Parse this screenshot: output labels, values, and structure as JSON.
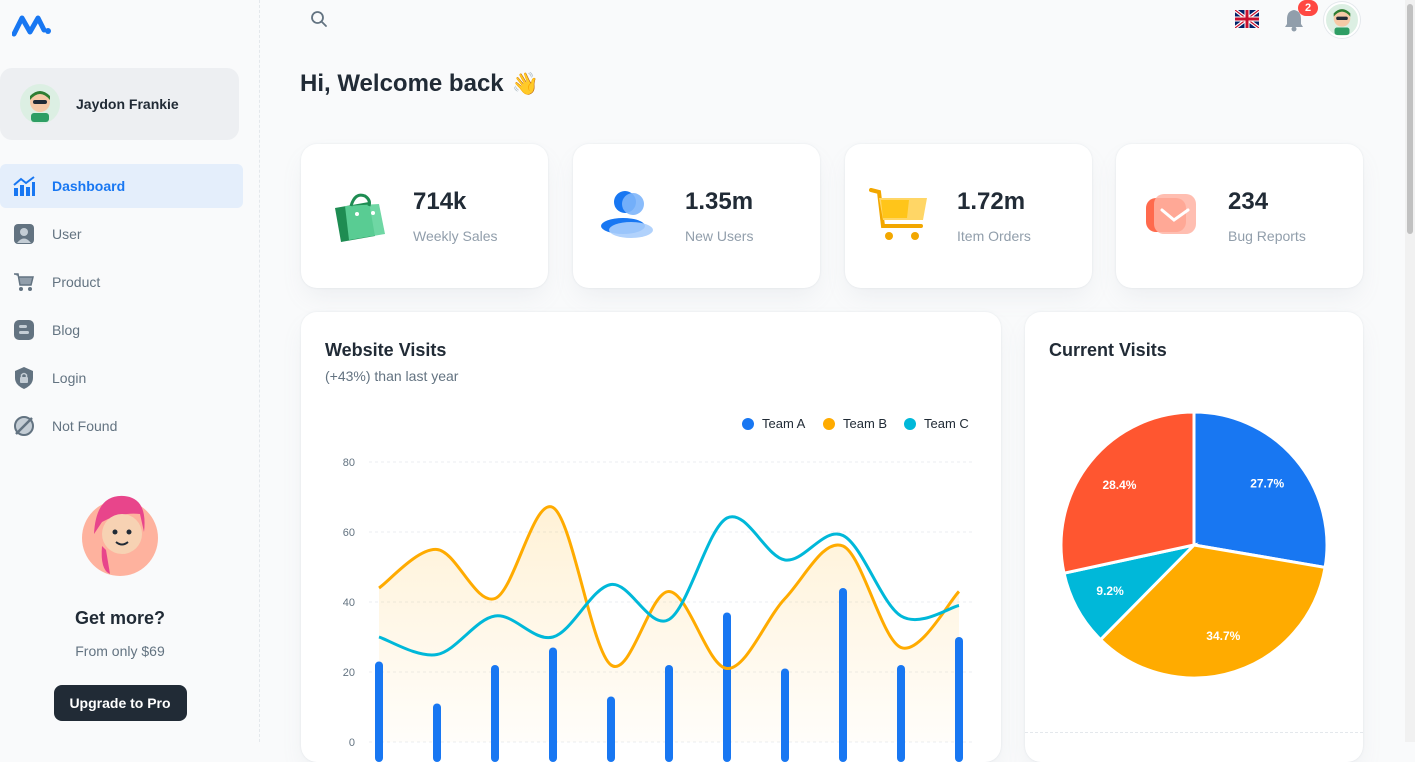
{
  "sidebar": {
    "account_name": "Jaydon Frankie",
    "items": [
      {
        "label": "Dashboard",
        "icon": "dashboard-icon",
        "active": true
      },
      {
        "label": "User",
        "icon": "user-icon",
        "active": false
      },
      {
        "label": "Product",
        "icon": "cart-icon",
        "active": false
      },
      {
        "label": "Blog",
        "icon": "blog-icon",
        "active": false
      },
      {
        "label": "Login",
        "icon": "lock-icon",
        "active": false
      },
      {
        "label": "Not Found",
        "icon": "not-found-icon",
        "active": false
      }
    ],
    "promo": {
      "title": "Get more?",
      "subtitle": "From only $69",
      "button": "Upgrade to Pro"
    }
  },
  "topbar": {
    "notifications": "2",
    "language_icon": "uk-flag-icon"
  },
  "greeting": {
    "text": "Hi, Welcome back",
    "emoji": "👋"
  },
  "stats": [
    {
      "value": "714k",
      "label": "Weekly Sales",
      "icon": "shopping-bag-icon",
      "color": "#2E9E64"
    },
    {
      "value": "1.35m",
      "label": "New Users",
      "icon": "users-icon",
      "color": "#1877F2"
    },
    {
      "value": "1.72m",
      "label": "Item Orders",
      "icon": "shopping-cart-icon",
      "color": "#FFC107"
    },
    {
      "value": "234",
      "label": "Bug Reports",
      "icon": "mail-icon",
      "color": "#FF7F5E"
    }
  ],
  "visits": {
    "title": "Website Visits",
    "subtitle": "(+43%) than last year"
  },
  "current_visits": {
    "title": "Current Visits"
  },
  "chart_data": [
    {
      "type": "line",
      "title": "Website Visits",
      "y_ticks": [
        "80",
        "60",
        "40",
        "20",
        "0"
      ],
      "ylim": [
        0,
        80
      ],
      "grid": true,
      "legend": "top-right",
      "series": [
        {
          "name": "Team A",
          "kind": "bar",
          "color": "#1877F2",
          "values": [
            23,
            11,
            22,
            27,
            13,
            22,
            37,
            21,
            44,
            22,
            30
          ]
        },
        {
          "name": "Team B",
          "kind": "area",
          "color": "#FFAB00",
          "values": [
            44,
            55,
            41,
            67,
            22,
            43,
            21,
            41,
            56,
            27,
            43
          ]
        },
        {
          "name": "Team C",
          "kind": "line",
          "color": "#00B8D9",
          "values": [
            30,
            25,
            36,
            30,
            45,
            35,
            64,
            52,
            59,
            36,
            39
          ]
        }
      ]
    },
    {
      "type": "pie",
      "title": "Current Visits",
      "slices": [
        {
          "label": "27.7%",
          "value": 27.7,
          "color": "#1877F2"
        },
        {
          "label": "34.7%",
          "value": 34.7,
          "color": "#FFAB00"
        },
        {
          "label": "9.2%",
          "value": 9.2,
          "color": "#00B8D9"
        },
        {
          "label": "28.4%",
          "value": 28.4,
          "color": "#FF5630"
        }
      ]
    }
  ]
}
